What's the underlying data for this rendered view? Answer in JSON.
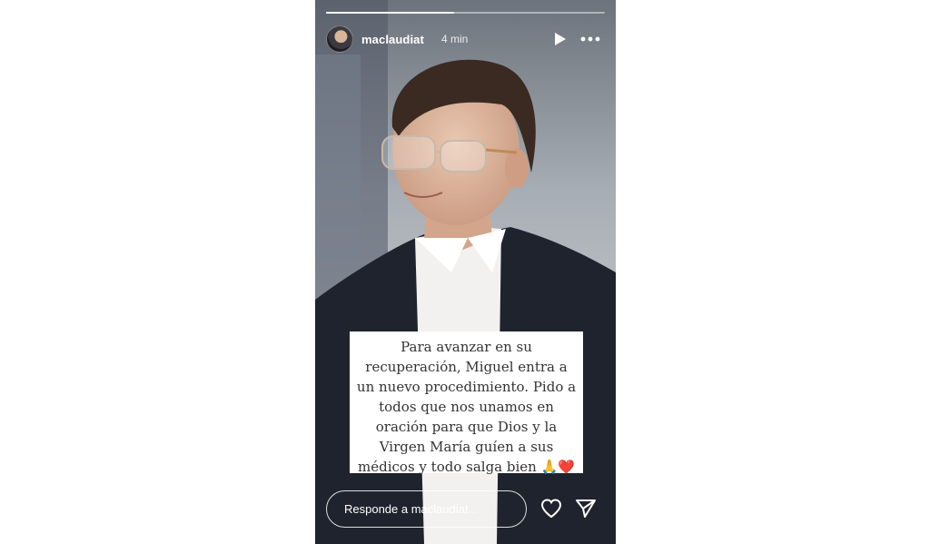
{
  "story": {
    "progress_fraction": 0.46,
    "user": {
      "username": "maclaudiat",
      "time": "4 min",
      "avatar_icon": "profile-avatar"
    },
    "controls": {
      "play_icon": "play-icon",
      "more_icon": "more-options-icon"
    },
    "caption": {
      "lines": [
        "Para avanzar en su",
        "recuperación, Miguel entra a",
        "un nuevo procedimiento. Pido a",
        "todos que nos unamos en",
        "oración para que Dios y la",
        "Virgen María guíen a sus",
        "médicos y todo salga bien"
      ],
      "emoji": "🙏❤️"
    },
    "reply": {
      "placeholder": "Responde a maclaudiat..."
    },
    "actions": {
      "heart_icon": "heart-icon",
      "send_icon": "send-icon"
    }
  }
}
